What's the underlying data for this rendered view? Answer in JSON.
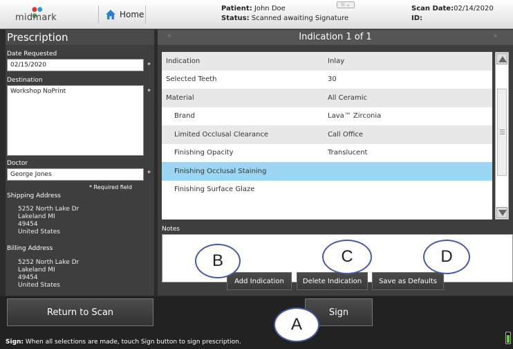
{
  "header": {
    "logo_text": "midmark",
    "home_label": "Home",
    "patient_label": "Patient:",
    "patient_name": "John Doe",
    "status_label": "Status:",
    "status_value": "Scanned awaiting Signature",
    "scan_date_label": "Scan Date:",
    "scan_date_value": "02/14/2020",
    "id_label": "ID:"
  },
  "prescription": {
    "title": "Prescription",
    "date_requested_label": "Date Requested",
    "date_requested_value": "02/15/2020",
    "destination_label": "Destination",
    "destination_value": "Workshop NoPrint",
    "doctor_label": "Doctor",
    "doctor_value": "George Jones",
    "required_marker": "*",
    "required_note": "* Required field",
    "shipping_label": "Shipping Address",
    "shipping_address": [
      "5252 North Lake Dr",
      "Lakeland MI",
      "49454",
      "United States"
    ],
    "billing_label": "Billing Address",
    "billing_address": [
      "5252 North Lake Dr",
      "Lakeland MI",
      "49454",
      "United States"
    ]
  },
  "indication": {
    "title": "Indication 1 of 1",
    "prev_arrow": "«",
    "next_arrow": "»",
    "rows": [
      {
        "key": "Indication",
        "value": "Inlay",
        "indent": false,
        "selected": false
      },
      {
        "key": "Selected Teeth",
        "value": "30",
        "indent": false,
        "selected": false
      },
      {
        "key": "Material",
        "value": "All Ceramic",
        "indent": false,
        "selected": false
      },
      {
        "key": "Brand",
        "value": "Lava™ Zirconia",
        "indent": true,
        "selected": false
      },
      {
        "key": "Limited Occlusal Clearance",
        "value": "Call Office",
        "indent": true,
        "selected": false
      },
      {
        "key": "Finishing Opacity",
        "value": "Translucent",
        "indent": true,
        "selected": false
      },
      {
        "key": "Finishing Occlusal Staining",
        "value": "",
        "indent": true,
        "selected": true
      },
      {
        "key": "Finishing Surface Glaze",
        "value": "",
        "indent": true,
        "selected": false
      }
    ],
    "notes_label": "Notes",
    "notes_value": ""
  },
  "buttons": {
    "add_indication": "Add Indication",
    "delete_indication": "Delete Indication",
    "save_defaults": "Save as Defaults",
    "return_to_scan": "Return to Scan",
    "sign": "Sign"
  },
  "callouts": {
    "a": "A",
    "b": "B",
    "c": "C",
    "d": "D"
  },
  "footer": {
    "hint_bold": "Sign:",
    "hint_text": "When all selections are made, touch Sign button to sign prescription."
  },
  "battery_level": 0.8,
  "colors": {
    "selected_row": "#9dd6f2",
    "callout_border": "#4a5a9a",
    "panel_bg": "#3e3e3e"
  }
}
